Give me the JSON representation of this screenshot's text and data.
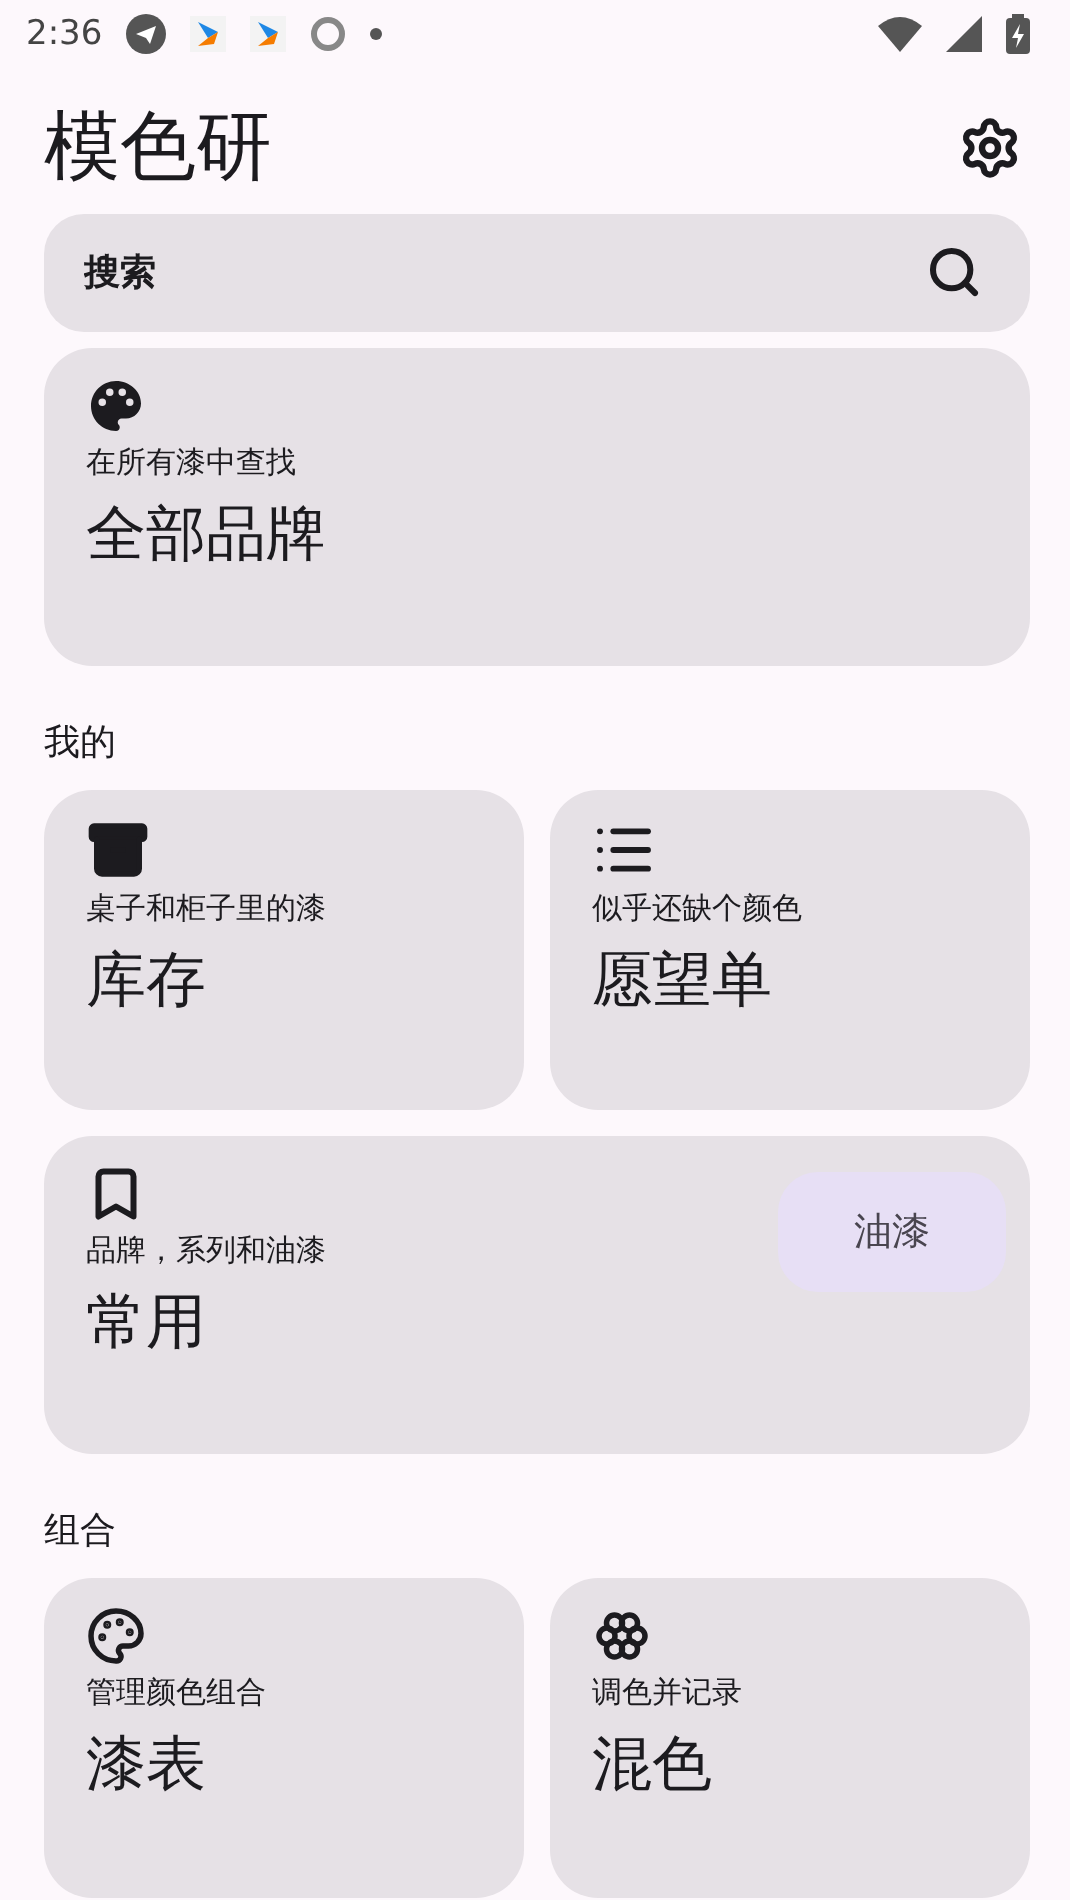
{
  "status_bar": {
    "time": "2:36"
  },
  "app_bar": {
    "title": "模色研"
  },
  "search": {
    "placeholder": "搜索"
  },
  "sections": [
    {
      "cards": [
        {
          "kind": "wide",
          "subtitle": "在所有漆中查找",
          "title": "全部品牌"
        }
      ]
    },
    {
      "heading": "我的",
      "cards": [
        {
          "kind": "half",
          "subtitle": "桌子和柜子里的漆",
          "title": "库存"
        },
        {
          "kind": "half",
          "subtitle": "似乎还缺个颜色",
          "title": "愿望单"
        },
        {
          "kind": "wide",
          "subtitle": "品牌，系列和油漆",
          "title": "常用",
          "chip": "油漆"
        }
      ]
    },
    {
      "heading": "组合",
      "cards": [
        {
          "kind": "half",
          "subtitle": "管理颜色组合",
          "title": "漆表"
        },
        {
          "kind": "half",
          "subtitle": "调色并记录",
          "title": "混色"
        }
      ]
    }
  ]
}
